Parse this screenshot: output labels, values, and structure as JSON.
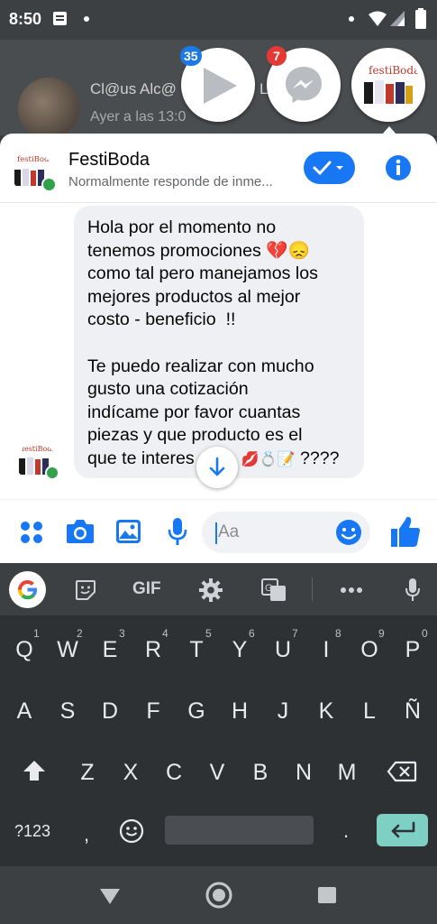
{
  "status_bar": {
    "time": "8:50"
  },
  "background_notification": {
    "name": "Cl@us Alc@",
    "subtitle": "Ayer a las 13:0",
    "trailing": "L"
  },
  "chat_heads": [
    {
      "name": "video-head",
      "badge": "35"
    },
    {
      "name": "messenger-head",
      "badge": "7"
    },
    {
      "name": "festiboda-head",
      "badge": ""
    }
  ],
  "conversation": {
    "logo_text": "festiBoda",
    "title": "FestiBoda",
    "subtitle": "Normalmente responde de inme...",
    "message_part1": "Hola por el momento no\ntenemos promociones",
    "message_part2": "como tal pero manejamos los\nmejores productos al mejor\ncosto - beneficio  !!",
    "message_part3": "Te puedo realizar con mucho\ngusto una cotización\nindícame por favor cuantas\npiezas y que producto es el\nque te interes",
    "message_tail": "????",
    "composer_placeholder": "Aa"
  },
  "keyboard": {
    "toolbar": {
      "gif": "GIF"
    },
    "row1": [
      {
        "k": "Q",
        "h": "1"
      },
      {
        "k": "W",
        "h": "2"
      },
      {
        "k": "E",
        "h": "3"
      },
      {
        "k": "R",
        "h": "4"
      },
      {
        "k": "T",
        "h": "5"
      },
      {
        "k": "Y",
        "h": "6"
      },
      {
        "k": "U",
        "h": "7"
      },
      {
        "k": "I",
        "h": "8"
      },
      {
        "k": "O",
        "h": "9"
      },
      {
        "k": "P",
        "h": "0"
      }
    ],
    "row2": [
      "A",
      "S",
      "D",
      "F",
      "G",
      "H",
      "J",
      "K",
      "L",
      "Ñ"
    ],
    "row3": [
      "Z",
      "X",
      "C",
      "V",
      "B",
      "N",
      "M"
    ],
    "symbols": "?123",
    "comma": ",",
    "period": "."
  },
  "colors": {
    "messenger_blue": "#1877f2",
    "keyboard_bg": "#2e3134",
    "enter_key": "#7ecfc4"
  }
}
